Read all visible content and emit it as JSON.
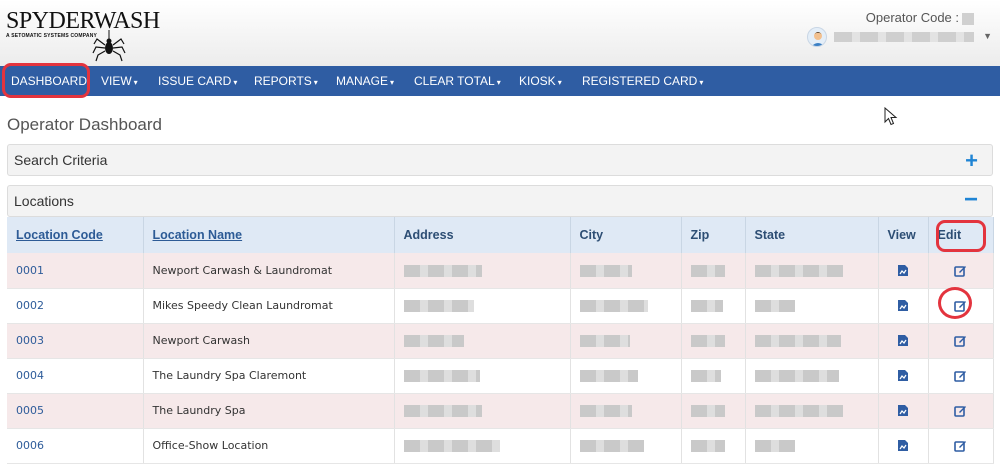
{
  "brand": {
    "logo_text": "SPYDERWASH",
    "tagline": "A SETOMATIC SYSTEMS COMPANY"
  },
  "header": {
    "operator_label": "Operator Code :"
  },
  "nav": {
    "items": [
      "DASHBOARD",
      "VIEW",
      "ISSUE CARD",
      "REPORTS",
      "MANAGE",
      "CLEAR TOTAL",
      "KIOSK",
      "REGISTERED CARD"
    ],
    "caret": "▾"
  },
  "page": {
    "title": "Operator Dashboard"
  },
  "search_panel": {
    "title": "Search Criteria",
    "toggle": "+"
  },
  "locations_panel": {
    "title": "Locations",
    "toggle": "−"
  },
  "table": {
    "columns": [
      "Location Code",
      "Location Name",
      "Address",
      "City",
      "Zip",
      "State",
      "View",
      "Edit"
    ],
    "rows": [
      {
        "code": "0001",
        "name": "Newport Carwash & Laundromat"
      },
      {
        "code": "0002",
        "name": "Mikes Speedy Clean Laundromat"
      },
      {
        "code": "0003",
        "name": "Newport Carwash"
      },
      {
        "code": "0004",
        "name": "The Laundry Spa Claremont"
      },
      {
        "code": "0005",
        "name": "The Laundry Spa"
      },
      {
        "code": "0006",
        "name": "Office-Show Location"
      }
    ]
  },
  "colors": {
    "nav_bg": "#2f5da3",
    "highlight": "#e3343e",
    "accent_blue": "#1f84d4",
    "row_alt": "#f6e9ea",
    "header_row": "#dfe9f5"
  },
  "icons": {
    "view": "document-view-icon",
    "edit": "edit-pencil-icon",
    "user": "user-avatar-icon"
  }
}
